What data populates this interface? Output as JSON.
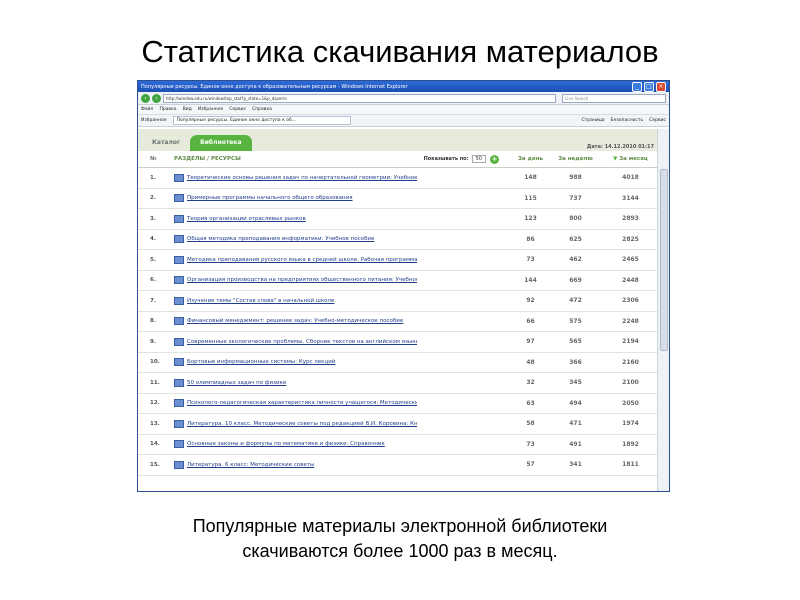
{
  "slide": {
    "title": "Статистика скачивания материалов",
    "caption_line1": "Популярные материалы электронной библиотеки",
    "caption_line2": "скачиваются более 1000 раз в месяц."
  },
  "browser": {
    "title": "Популярные ресурсы. Единое окно доступа к образовательным ресурсам - Windows Internet Explorer",
    "url": "http://window.edu.ru/window/top_stat?p_state=1&p_dsperm",
    "search_placeholder": "Live Search",
    "menu": [
      "Файл",
      "Правка",
      "Вид",
      "Избранное",
      "Сервис",
      "Справка"
    ],
    "favorites_label": "Избранное",
    "tab_title": "Популярные ресурсы. Единое окно доступа к об...",
    "tools": [
      "Страница",
      "Безопасность",
      "Сервис"
    ]
  },
  "page": {
    "tabs": [
      "Каталог",
      "Библиотека"
    ],
    "header": {
      "num": "№",
      "sections": "РАЗДЕЛЫ / РЕСУРСЫ",
      "show_by": "Показывать по:",
      "show_by_value": "50",
      "date": "Дата: 14.12.2010 01:17",
      "day": "За день",
      "week": "За неделю",
      "month": "За месяц"
    },
    "rows": [
      {
        "num": "1.",
        "title": "Теоретические основы решения задач по начертательной геометрии: Учебное пособие",
        "day": "148",
        "week": "988",
        "month": "4018"
      },
      {
        "num": "2.",
        "title": "Примерные программы начального общего образования",
        "day": "115",
        "week": "737",
        "month": "3144"
      },
      {
        "num": "3.",
        "title": "Теория организации отраслевых рынков",
        "day": "123",
        "week": "800",
        "month": "2893"
      },
      {
        "num": "4.",
        "title": "Общая методика преподавания информатики: Учебное пособие",
        "day": "86",
        "week": "625",
        "month": "2825"
      },
      {
        "num": "5.",
        "title": "Методика преподавания русского языка в средней школе. Рабочая программа курса",
        "day": "73",
        "week": "462",
        "month": "2465"
      },
      {
        "num": "6.",
        "title": "Организация производства на предприятиях общественного питания: Учебное пособие",
        "day": "144",
        "week": "669",
        "month": "2448"
      },
      {
        "num": "7.",
        "title": "Изучение темы \"Состав слова\" в начальной школе",
        "day": "92",
        "week": "472",
        "month": "2306"
      },
      {
        "num": "8.",
        "title": "Финансовый менеджмент: решение задач: Учебно-методическое пособие",
        "day": "66",
        "week": "575",
        "month": "2248"
      },
      {
        "num": "9.",
        "title": "Современные экологические проблемы. Сборник текстов на английском языке для студентов неязыковых вузов",
        "day": "97",
        "week": "565",
        "month": "2194"
      },
      {
        "num": "10.",
        "title": "Бортовые информационные системы: Курс лекций",
        "day": "48",
        "week": "366",
        "month": "2160"
      },
      {
        "num": "11.",
        "title": "50 олимпиадных задач по физике",
        "day": "32",
        "week": "345",
        "month": "2100"
      },
      {
        "num": "12.",
        "title": "Психолого-педагогическая характеристика личности учащегося: Методические указания",
        "day": "63",
        "week": "494",
        "month": "2050"
      },
      {
        "num": "13.",
        "title": "Литература. 10 класс. Методические советы под редакцией В.И. Коровина: Книга для учителя",
        "day": "58",
        "week": "471",
        "month": "1974"
      },
      {
        "num": "14.",
        "title": "Основные законы и формулы по математике и физике: Справочник",
        "day": "73",
        "week": "491",
        "month": "1892"
      },
      {
        "num": "15.",
        "title": "Литература. 6 класс: Методические советы",
        "day": "57",
        "week": "341",
        "month": "1811"
      }
    ]
  }
}
